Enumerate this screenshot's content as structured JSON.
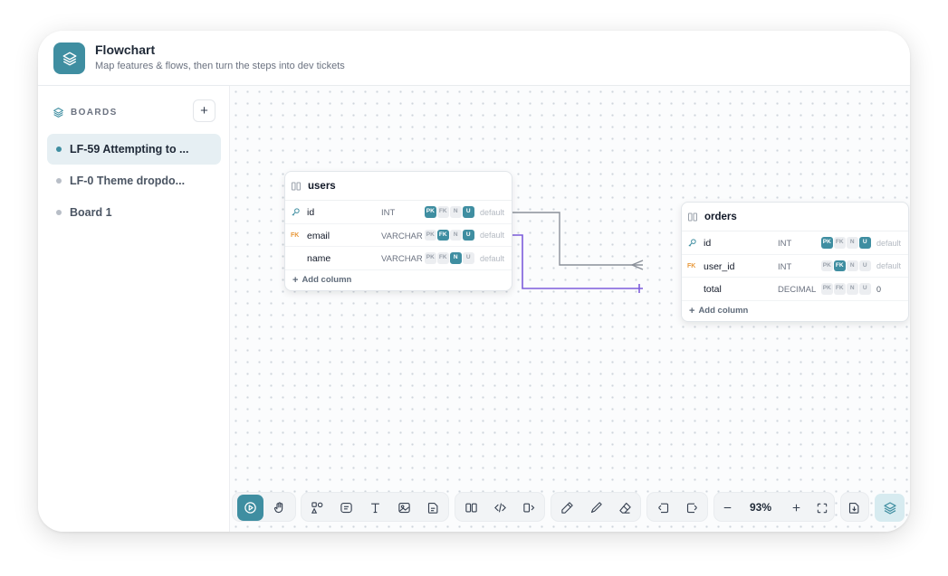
{
  "header": {
    "title": "Flowchart",
    "subtitle": "Map features & flows, then turn the steps into dev tickets",
    "logo_icon": "layers-icon"
  },
  "sidebar": {
    "section_label": "BOARDS",
    "add_label": "+",
    "items": [
      {
        "label": "LF-59 Attempting to ...",
        "active": true
      },
      {
        "label": "LF-0 Theme dropdo...",
        "active": false
      },
      {
        "label": "Board 1",
        "active": false
      }
    ]
  },
  "tables": {
    "users": {
      "name": "users",
      "rows": [
        {
          "name": "id",
          "type": "INT",
          "pk": "PK",
          "fk": "FK",
          "n": "N",
          "u": "U",
          "default": "default",
          "key": "pk"
        },
        {
          "name": "email",
          "type": "VARCHAR",
          "pk": "PK",
          "fk": "FK",
          "n": "N",
          "u": "U",
          "default": "default",
          "key": "fk",
          "key_label": "FK"
        },
        {
          "name": "name",
          "type": "VARCHAR",
          "pk": "PK",
          "fk": "FK",
          "n": "N",
          "u": "U",
          "default": "default"
        }
      ],
      "add_column": "Add column"
    },
    "orders": {
      "name": "orders",
      "rows": [
        {
          "name": "id",
          "type": "INT",
          "pk": "PK",
          "fk": "FK",
          "n": "N",
          "u": "U",
          "default": "default",
          "key": "pk"
        },
        {
          "name": "user_id",
          "type": "INT",
          "pk": "PK",
          "fk": "FK",
          "n": "N",
          "u": "U",
          "default": "default",
          "key": "fk",
          "key_label": "FK"
        },
        {
          "name": "total",
          "type": "DECIMAL",
          "pk": "PK",
          "fk": "FK",
          "n": "N",
          "u": "U",
          "default": "0"
        }
      ],
      "add_column": "Add column"
    }
  },
  "toolbar": {
    "zoom": "93%",
    "accent": "#3f8ea1",
    "icons": [
      "select-icon",
      "hand-icon",
      "shapes-icon",
      "note-icon",
      "text-icon",
      "image-icon",
      "document-icon",
      "table-icon",
      "code-icon",
      "component-icon",
      "pencil-icon",
      "pen-icon",
      "eraser-icon",
      "undo-icon",
      "redo-icon",
      "zoom-out-icon",
      "zoom-in-icon",
      "fit-screen-icon",
      "export-icon",
      "layers-icon"
    ]
  },
  "colors": {
    "accent": "#3f8ea1",
    "relation_gray": "#8a9099",
    "relation_purple": "#7c5cdb",
    "fk_marker": "#e8983a"
  }
}
